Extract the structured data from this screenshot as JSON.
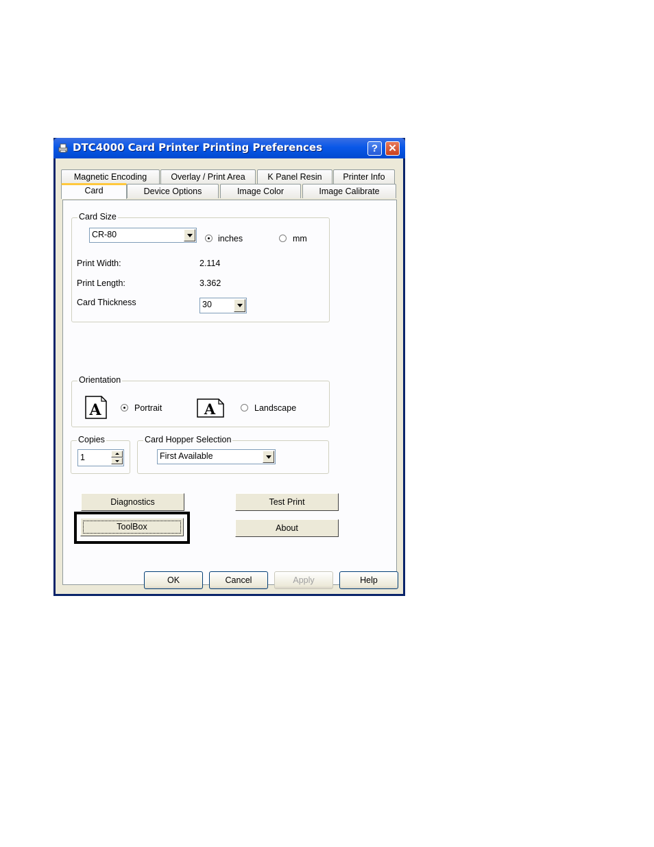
{
  "window": {
    "title": "DTC4000 Card Printer Printing Preferences",
    "help_glyph": "?",
    "close_glyph": "✕"
  },
  "tabs_row1": [
    "Magnetic Encoding",
    "Overlay / Print Area",
    "K Panel Resin",
    "Printer Info"
  ],
  "tabs_row2": [
    "Card",
    "Device Options",
    "Image Color",
    "Image Calibrate"
  ],
  "active_tab": "Card",
  "card_size": {
    "label": "Card Size",
    "selected": "CR-80",
    "unit_inches": "inches",
    "unit_mm": "mm",
    "unit_selected": "inches",
    "print_width_label": "Print Width:",
    "print_width_value": "2.114",
    "print_length_label": "Print Length:",
    "print_length_value": "3.362",
    "thickness_label": "Card Thickness",
    "thickness_value": "30"
  },
  "orientation": {
    "label": "Orientation",
    "portrait": "Portrait",
    "landscape": "Landscape",
    "selected": "Portrait",
    "icon_glyph": "A"
  },
  "copies": {
    "label": "Copies",
    "value": "1"
  },
  "hopper": {
    "label": "Card Hopper Selection",
    "selected": "First Available"
  },
  "buttons": {
    "diagnostics": "Diagnostics",
    "toolbox": "ToolBox",
    "test_print": "Test Print",
    "about": "About",
    "ok": "OK",
    "cancel": "Cancel",
    "apply": "Apply",
    "help": "Help"
  }
}
